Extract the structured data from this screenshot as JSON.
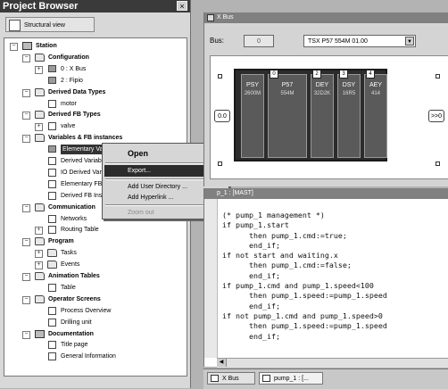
{
  "project_browser": {
    "title": "Project Browser",
    "close_glyph": "×",
    "view_button": "Structural view",
    "tree": [
      {
        "label": "Station",
        "depth": 0,
        "bold": true,
        "icon": "station",
        "expander": "−"
      },
      {
        "label": "Configuration",
        "depth": 1,
        "bold": true,
        "icon": "folder",
        "expander": "−"
      },
      {
        "label": "0 : X Bus",
        "depth": 2,
        "bold": false,
        "icon": "leaf",
        "expander": "+"
      },
      {
        "label": "2 : Fipio",
        "depth": 2,
        "bold": false,
        "icon": "leaf",
        "expander": ""
      },
      {
        "label": "Derived Data Types",
        "depth": 1,
        "bold": true,
        "icon": "folder",
        "expander": "−"
      },
      {
        "label": "motor",
        "depth": 2,
        "bold": false,
        "icon": "doc",
        "expander": ""
      },
      {
        "label": "Derived FB Types",
        "depth": 1,
        "bold": true,
        "icon": "folder",
        "expander": "−"
      },
      {
        "label": "valve",
        "depth": 2,
        "bold": false,
        "icon": "doc",
        "expander": "+"
      },
      {
        "label": "Variables & FB instances",
        "depth": 1,
        "bold": true,
        "icon": "folder",
        "expander": "−"
      },
      {
        "label": "Elementary Variables",
        "depth": 2,
        "bold": false,
        "icon": "leaf",
        "expander": "",
        "selected": true
      },
      {
        "label": "Derived Variab",
        "depth": 2,
        "bold": false,
        "icon": "doc",
        "expander": ""
      },
      {
        "label": "IO Derived Vari",
        "depth": 2,
        "bold": false,
        "icon": "doc",
        "expander": ""
      },
      {
        "label": "Elementary FB I",
        "depth": 2,
        "bold": false,
        "icon": "doc",
        "expander": ""
      },
      {
        "label": "Derived FB Ins",
        "depth": 2,
        "bold": false,
        "icon": "doc",
        "expander": ""
      },
      {
        "label": "Communication",
        "depth": 1,
        "bold": true,
        "icon": "folder",
        "expander": "−"
      },
      {
        "label": "Networks",
        "depth": 2,
        "bold": false,
        "icon": "doc",
        "expander": ""
      },
      {
        "label": "Routing Table",
        "depth": 2,
        "bold": false,
        "icon": "doc",
        "expander": "+"
      },
      {
        "label": "Program",
        "depth": 1,
        "bold": true,
        "icon": "folder",
        "expander": "−"
      },
      {
        "label": "Tasks",
        "depth": 2,
        "bold": false,
        "icon": "folder",
        "expander": "+"
      },
      {
        "label": "Events",
        "depth": 2,
        "bold": false,
        "icon": "folder",
        "expander": "+"
      },
      {
        "label": "Animation Tables",
        "depth": 1,
        "bold": true,
        "icon": "folder",
        "expander": "−"
      },
      {
        "label": "Table",
        "depth": 2,
        "bold": false,
        "icon": "doc",
        "expander": ""
      },
      {
        "label": "Operator Screens",
        "depth": 1,
        "bold": true,
        "icon": "folder",
        "expander": "−"
      },
      {
        "label": "Process Overview",
        "depth": 2,
        "bold": false,
        "icon": "doc",
        "expander": ""
      },
      {
        "label": "Drilling unit",
        "depth": 2,
        "bold": false,
        "icon": "doc",
        "expander": ""
      },
      {
        "label": "Documentation",
        "depth": 1,
        "bold": true,
        "icon": "station",
        "expander": "−"
      },
      {
        "label": "Title page",
        "depth": 2,
        "bold": false,
        "icon": "doc",
        "expander": ""
      },
      {
        "label": "General Information",
        "depth": 2,
        "bold": false,
        "icon": "doc",
        "expander": ""
      }
    ]
  },
  "context_menu": {
    "open": "Open",
    "export": "Export...",
    "add_user_directory": "Add User Directory ...",
    "add_hyperlink": "Add Hyperlink ...",
    "zoom_out": "Zoom out"
  },
  "xbus": {
    "title": "X Bus",
    "bus_label": "Bus:",
    "bus_number": "0",
    "processor": "TSX P57 554M  01.00",
    "nav_left": "0.0",
    "nav_right": ">>0",
    "modules": [
      {
        "slot": "",
        "name": "PSY",
        "sub": "2600M"
      },
      {
        "slot": "0",
        "name": "P57",
        "sub": "554M"
      },
      {
        "slot": "2",
        "name": "DEY",
        "sub": "32D2K"
      },
      {
        "slot": "3",
        "name": "DSY",
        "sub": "16R5"
      },
      {
        "slot": "4",
        "name": "AEY",
        "sub": "414"
      }
    ]
  },
  "code_window": {
    "title": "p_1 : [MAST]",
    "lines": [
      "(* pump_1 management *)",
      "if pump_1.start",
      "      then pump_1.cmd:=true;",
      "      end_if;",
      "if not start and waiting.x",
      "      then pump_1.cmd:=false;",
      "      end_if;",
      "if pump_1.cmd and pump_1.speed<100",
      "      then pump_1.speed:=pump_1.speed",
      "      end_if;",
      "if not pump_1.cmd and pump_1.speed>0",
      "      then pump_1.speed:=pump_1.speed",
      "      end_if;"
    ]
  },
  "tabs": [
    {
      "label": "X Bus"
    },
    {
      "label": "pump_1 : [..."
    }
  ]
}
